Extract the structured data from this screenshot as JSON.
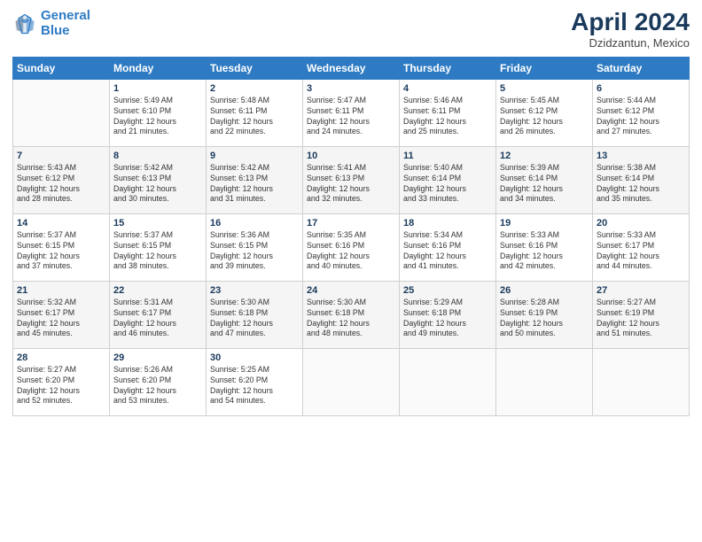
{
  "logo": {
    "line1": "General",
    "line2": "Blue"
  },
  "title": "April 2024",
  "location": "Dzidzantun, Mexico",
  "days_of_week": [
    "Sunday",
    "Monday",
    "Tuesday",
    "Wednesday",
    "Thursday",
    "Friday",
    "Saturday"
  ],
  "weeks": [
    [
      {
        "day": "",
        "info": ""
      },
      {
        "day": "1",
        "info": "Sunrise: 5:49 AM\nSunset: 6:10 PM\nDaylight: 12 hours\nand 21 minutes."
      },
      {
        "day": "2",
        "info": "Sunrise: 5:48 AM\nSunset: 6:11 PM\nDaylight: 12 hours\nand 22 minutes."
      },
      {
        "day": "3",
        "info": "Sunrise: 5:47 AM\nSunset: 6:11 PM\nDaylight: 12 hours\nand 24 minutes."
      },
      {
        "day": "4",
        "info": "Sunrise: 5:46 AM\nSunset: 6:11 PM\nDaylight: 12 hours\nand 25 minutes."
      },
      {
        "day": "5",
        "info": "Sunrise: 5:45 AM\nSunset: 6:12 PM\nDaylight: 12 hours\nand 26 minutes."
      },
      {
        "day": "6",
        "info": "Sunrise: 5:44 AM\nSunset: 6:12 PM\nDaylight: 12 hours\nand 27 minutes."
      }
    ],
    [
      {
        "day": "7",
        "info": "Sunrise: 5:43 AM\nSunset: 6:12 PM\nDaylight: 12 hours\nand 28 minutes."
      },
      {
        "day": "8",
        "info": "Sunrise: 5:42 AM\nSunset: 6:13 PM\nDaylight: 12 hours\nand 30 minutes."
      },
      {
        "day": "9",
        "info": "Sunrise: 5:42 AM\nSunset: 6:13 PM\nDaylight: 12 hours\nand 31 minutes."
      },
      {
        "day": "10",
        "info": "Sunrise: 5:41 AM\nSunset: 6:13 PM\nDaylight: 12 hours\nand 32 minutes."
      },
      {
        "day": "11",
        "info": "Sunrise: 5:40 AM\nSunset: 6:14 PM\nDaylight: 12 hours\nand 33 minutes."
      },
      {
        "day": "12",
        "info": "Sunrise: 5:39 AM\nSunset: 6:14 PM\nDaylight: 12 hours\nand 34 minutes."
      },
      {
        "day": "13",
        "info": "Sunrise: 5:38 AM\nSunset: 6:14 PM\nDaylight: 12 hours\nand 35 minutes."
      }
    ],
    [
      {
        "day": "14",
        "info": "Sunrise: 5:37 AM\nSunset: 6:15 PM\nDaylight: 12 hours\nand 37 minutes."
      },
      {
        "day": "15",
        "info": "Sunrise: 5:37 AM\nSunset: 6:15 PM\nDaylight: 12 hours\nand 38 minutes."
      },
      {
        "day": "16",
        "info": "Sunrise: 5:36 AM\nSunset: 6:15 PM\nDaylight: 12 hours\nand 39 minutes."
      },
      {
        "day": "17",
        "info": "Sunrise: 5:35 AM\nSunset: 6:16 PM\nDaylight: 12 hours\nand 40 minutes."
      },
      {
        "day": "18",
        "info": "Sunrise: 5:34 AM\nSunset: 6:16 PM\nDaylight: 12 hours\nand 41 minutes."
      },
      {
        "day": "19",
        "info": "Sunrise: 5:33 AM\nSunset: 6:16 PM\nDaylight: 12 hours\nand 42 minutes."
      },
      {
        "day": "20",
        "info": "Sunrise: 5:33 AM\nSunset: 6:17 PM\nDaylight: 12 hours\nand 44 minutes."
      }
    ],
    [
      {
        "day": "21",
        "info": "Sunrise: 5:32 AM\nSunset: 6:17 PM\nDaylight: 12 hours\nand 45 minutes."
      },
      {
        "day": "22",
        "info": "Sunrise: 5:31 AM\nSunset: 6:17 PM\nDaylight: 12 hours\nand 46 minutes."
      },
      {
        "day": "23",
        "info": "Sunrise: 5:30 AM\nSunset: 6:18 PM\nDaylight: 12 hours\nand 47 minutes."
      },
      {
        "day": "24",
        "info": "Sunrise: 5:30 AM\nSunset: 6:18 PM\nDaylight: 12 hours\nand 48 minutes."
      },
      {
        "day": "25",
        "info": "Sunrise: 5:29 AM\nSunset: 6:18 PM\nDaylight: 12 hours\nand 49 minutes."
      },
      {
        "day": "26",
        "info": "Sunrise: 5:28 AM\nSunset: 6:19 PM\nDaylight: 12 hours\nand 50 minutes."
      },
      {
        "day": "27",
        "info": "Sunrise: 5:27 AM\nSunset: 6:19 PM\nDaylight: 12 hours\nand 51 minutes."
      }
    ],
    [
      {
        "day": "28",
        "info": "Sunrise: 5:27 AM\nSunset: 6:20 PM\nDaylight: 12 hours\nand 52 minutes."
      },
      {
        "day": "29",
        "info": "Sunrise: 5:26 AM\nSunset: 6:20 PM\nDaylight: 12 hours\nand 53 minutes."
      },
      {
        "day": "30",
        "info": "Sunrise: 5:25 AM\nSunset: 6:20 PM\nDaylight: 12 hours\nand 54 minutes."
      },
      {
        "day": "",
        "info": ""
      },
      {
        "day": "",
        "info": ""
      },
      {
        "day": "",
        "info": ""
      },
      {
        "day": "",
        "info": ""
      }
    ]
  ]
}
